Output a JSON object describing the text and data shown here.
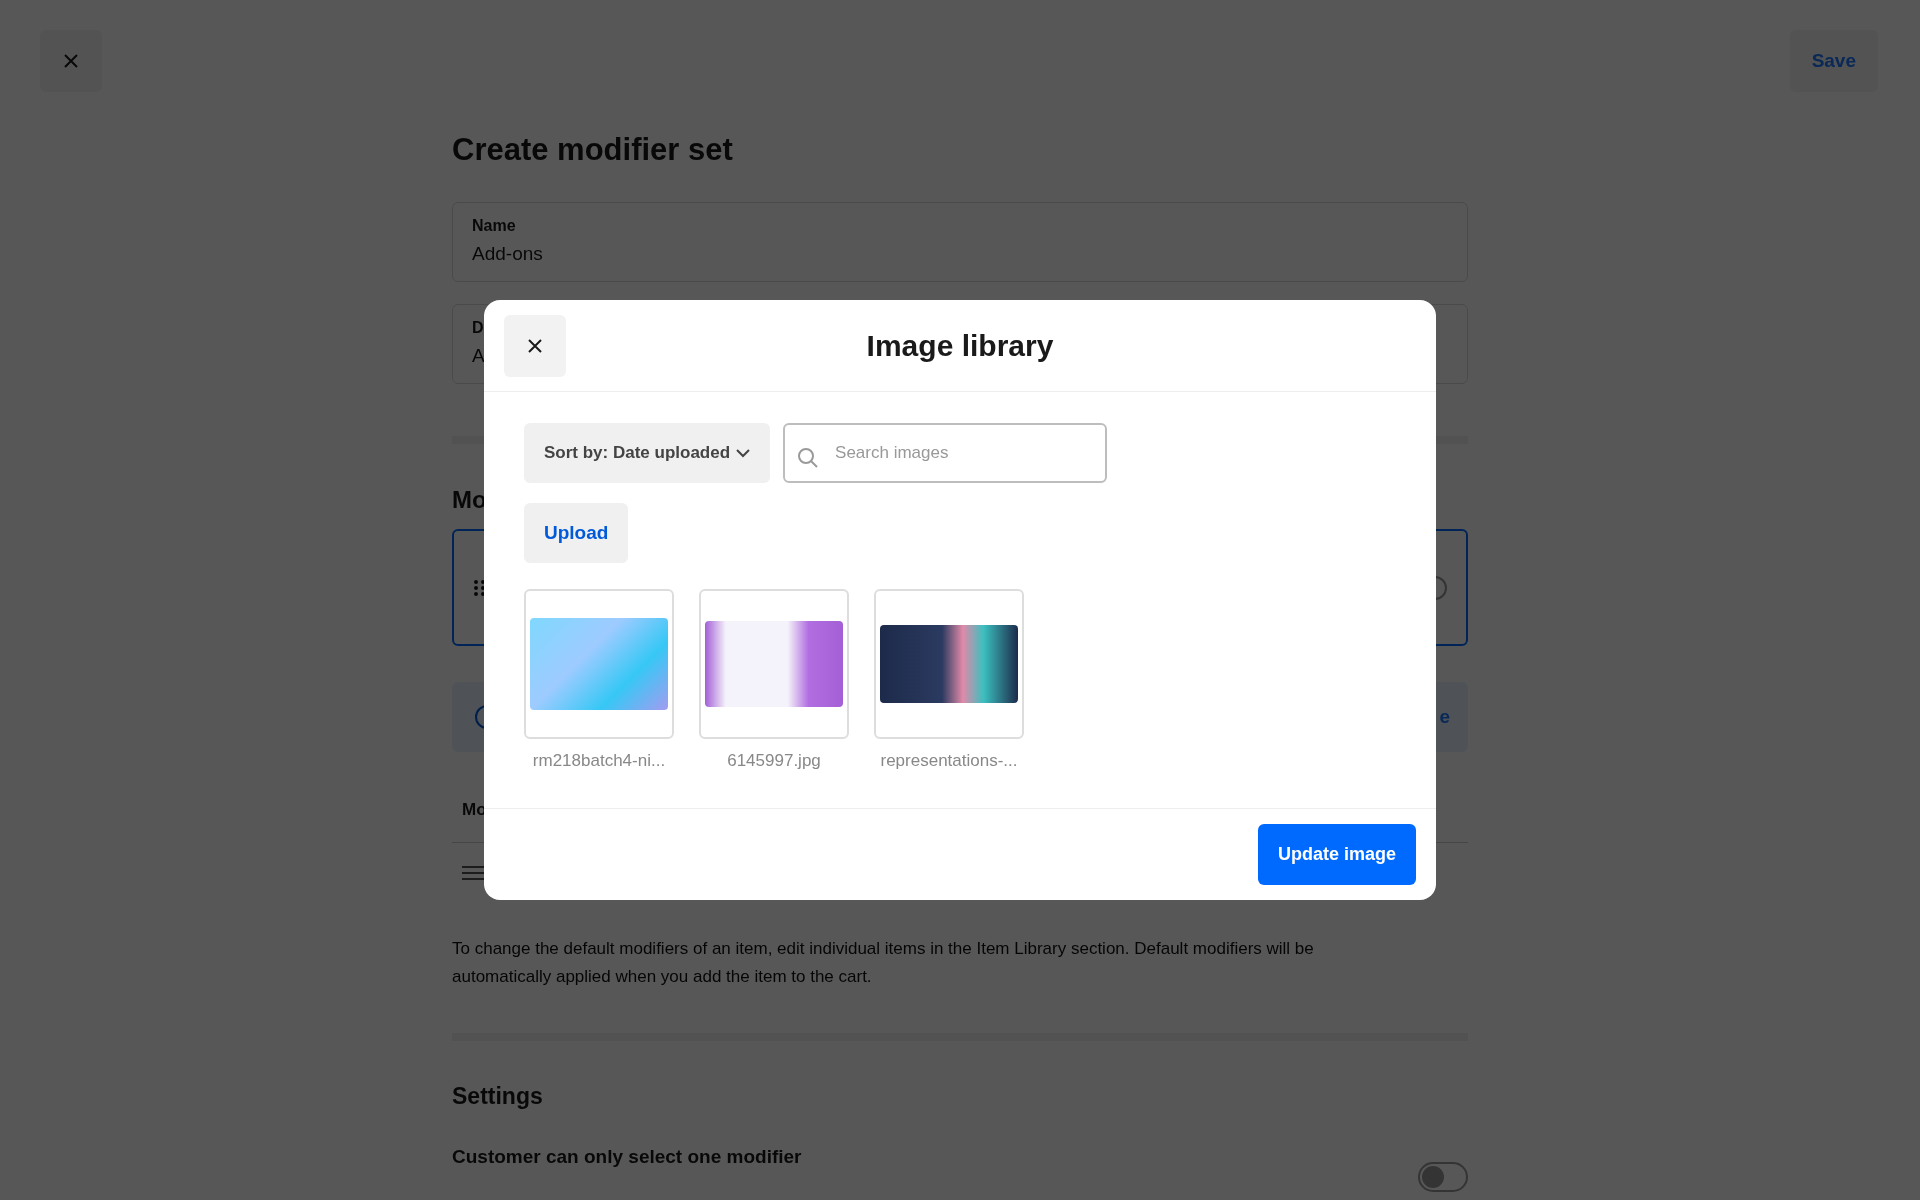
{
  "page": {
    "save_label": "Save",
    "title": "Create modifier set",
    "fields": [
      {
        "label": "Name",
        "value": "Add-ons"
      },
      {
        "label": "D",
        "value": "A"
      }
    ],
    "section_heading": "Mo",
    "banner_text": "e",
    "column_header": "Mo",
    "note": "To change the default modifiers of an item, edit individual items in the Item Library section. Default modifiers will be automatically applied when you add the item to the cart.",
    "settings_heading": "Settings",
    "setting_label": "Customer can only select one modifier",
    "setting_on": false
  },
  "modal": {
    "title": "Image library",
    "sort_label": "Sort by: Date uploaded",
    "search": {
      "placeholder": "Search images"
    },
    "upload_label": "Upload",
    "images": [
      {
        "caption": "rm218batch4-ni...",
        "kind": "gradient"
      },
      {
        "caption": "6145997.jpg",
        "kind": "purple"
      },
      {
        "caption": "representations-...",
        "kind": "dark"
      }
    ],
    "primary_button": "Update image"
  }
}
